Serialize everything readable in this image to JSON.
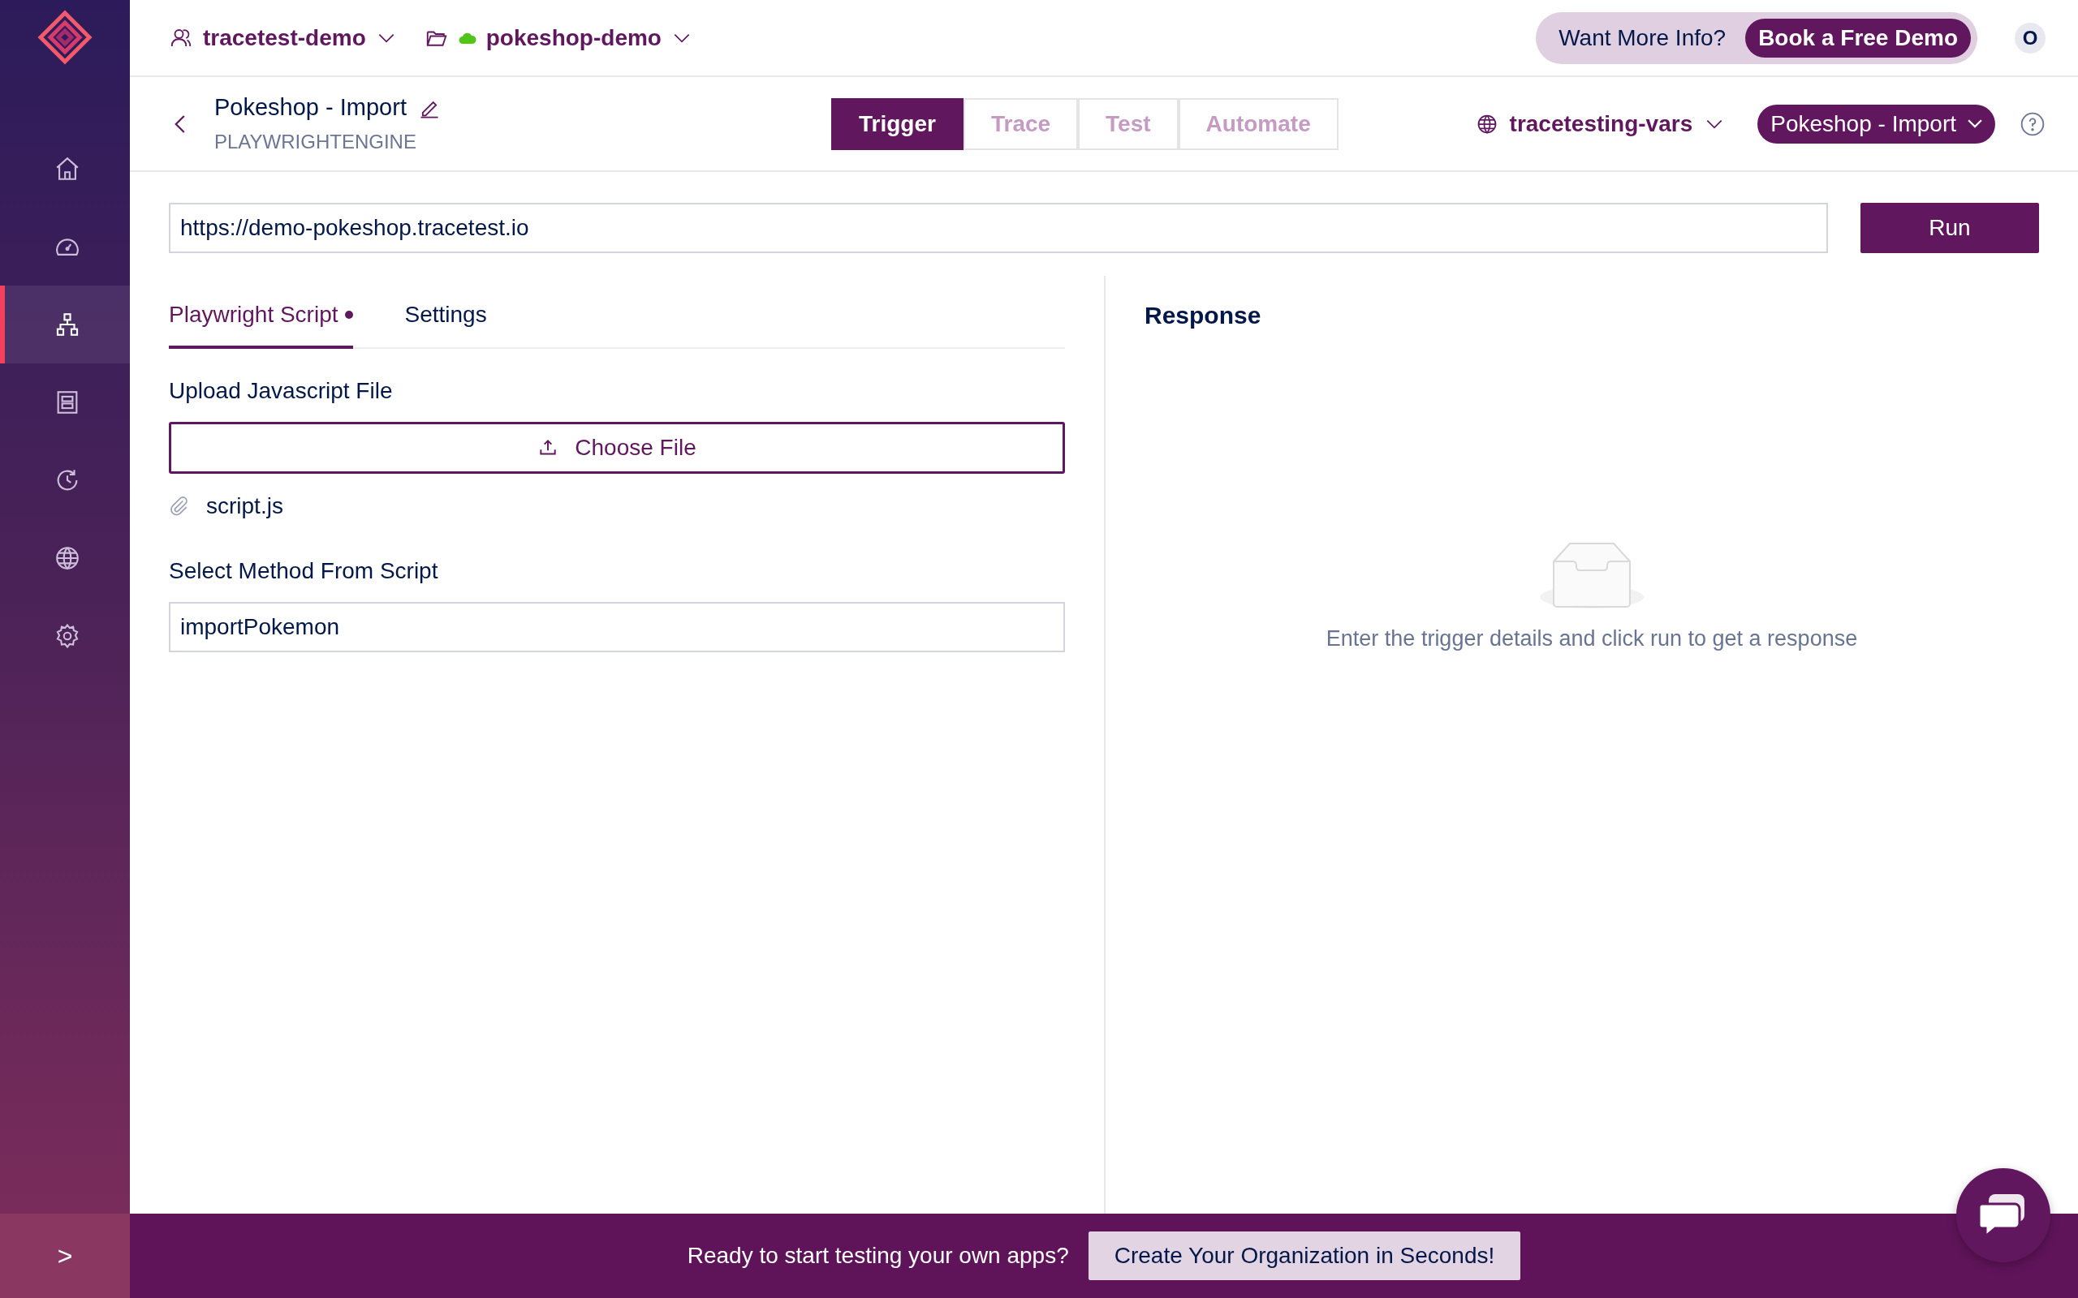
{
  "sidebar": {
    "items": [
      {
        "selected": false
      },
      {
        "selected": false
      },
      {
        "selected": true
      },
      {
        "selected": false
      },
      {
        "selected": false
      },
      {
        "selected": false
      },
      {
        "selected": false
      }
    ],
    "expand": ">"
  },
  "topbar": {
    "organization": "tracetest-demo",
    "environment": "pokeshop-demo",
    "promo": "Want More Info?",
    "promo_button": "Book a Free Demo",
    "avatar": "O"
  },
  "header": {
    "title": "Pokeshop - Import",
    "subtitle": "PLAYWRIGHTENGINE",
    "mode_tabs": [
      {
        "label": "Trigger",
        "selected": true
      },
      {
        "label": "Trace",
        "selected": false
      },
      {
        "label": "Test",
        "selected": false
      },
      {
        "label": "Automate",
        "selected": false
      }
    ],
    "variable_set": "tracetesting-vars",
    "test_selector": "Pokeshop - Import"
  },
  "trigger": {
    "url": "https://demo-pokeshop.tracetest.io",
    "run_button": "Run",
    "tabs": [
      {
        "label": "Playwright Script",
        "selected": true,
        "modified": true
      },
      {
        "label": "Settings",
        "selected": false,
        "modified": false
      }
    ],
    "upload_label": "Upload Javascript File",
    "choose_file_button": "Choose File",
    "file_name": "script.js",
    "method_label": "Select Method From Script",
    "method_value": "importPokemon"
  },
  "response": {
    "title": "Response",
    "empty_message": "Enter the trigger details and click run to get a response"
  },
  "banner": {
    "text": "Ready to start testing your own apps?",
    "button": "Create Your Organization in Seconds!"
  }
}
